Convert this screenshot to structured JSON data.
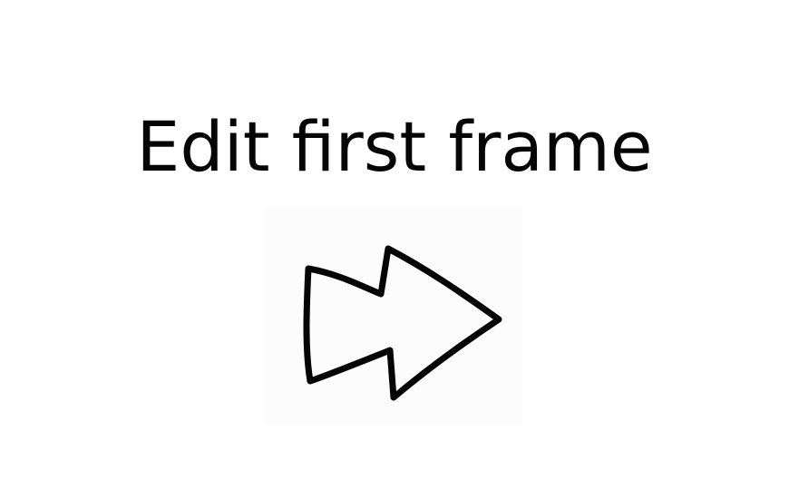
{
  "title": "Edit first frame",
  "icon": "forward-arrow-icon",
  "colors": {
    "background": "#ffffff",
    "ink": "#050505"
  }
}
